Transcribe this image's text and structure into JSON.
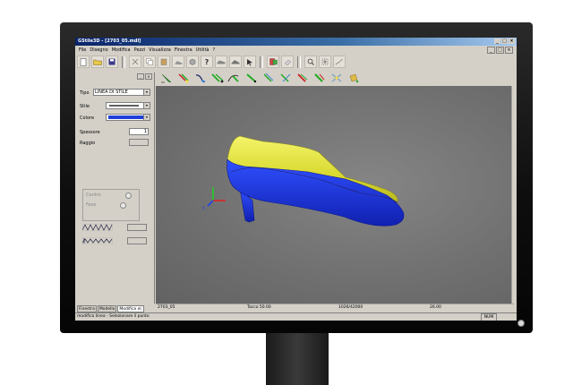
{
  "window": {
    "title": "GStile3D - [2703_05.mdl]",
    "controls": [
      "_",
      "□",
      "×"
    ]
  },
  "menu": [
    "File",
    "Disegno",
    "Modifica",
    "Pezzi",
    "Visualizza",
    "Finestra",
    "Utilità",
    "?"
  ],
  "panel": {
    "tipo_label": "Tipo",
    "tipo_value": "LINEA DI STILE",
    "stile_label": "Stile",
    "colore_label": "Colore",
    "colore_value": "#1f3fd8",
    "spessore_label": "Spessore",
    "spessore_value": "1",
    "raggio_label": "Raggio",
    "radio1_label": "Centro",
    "radio2_label": "Fase",
    "tabs": [
      "Finestra",
      "Modello",
      "Modifica el."
    ]
  },
  "status": {
    "file": "2703_05",
    "zoom": "Tacco 50.00",
    "coords": "1026/42000",
    "value": "26.00",
    "message": "modifica linea - Selezionare il punto",
    "num": "NUM"
  },
  "icons": {
    "toolbar1": [
      "new-file-icon",
      "open-folder-icon",
      "save-icon",
      "cut-icon",
      "copy-icon",
      "paste-icon",
      "shoe-view-icon",
      "cube-view-icon",
      "help-icon",
      "shoe-side-icon",
      "shoe-top-icon",
      "pointer-icon",
      "layers-icon",
      "eraser-icon",
      "zoom-in-icon",
      "zoom-box-icon",
      "measure-icon"
    ],
    "toolbar2": [
      "pen-green-icon",
      "pen-multi-icon",
      "pen-blue-icon",
      "pen-dual-icon",
      "pen-curve-icon",
      "pen-split-icon",
      "pen-offset-icon",
      "pen-mirror-icon",
      "pen-red-icon",
      "pen-join-icon",
      "tool-cross-icon",
      "tool-bucket-icon"
    ]
  },
  "colors": {
    "upper": "#e8e832",
    "sole": "#1c3ce0",
    "heel": "#1c3ce0",
    "viewport": "#7a7a7a"
  }
}
